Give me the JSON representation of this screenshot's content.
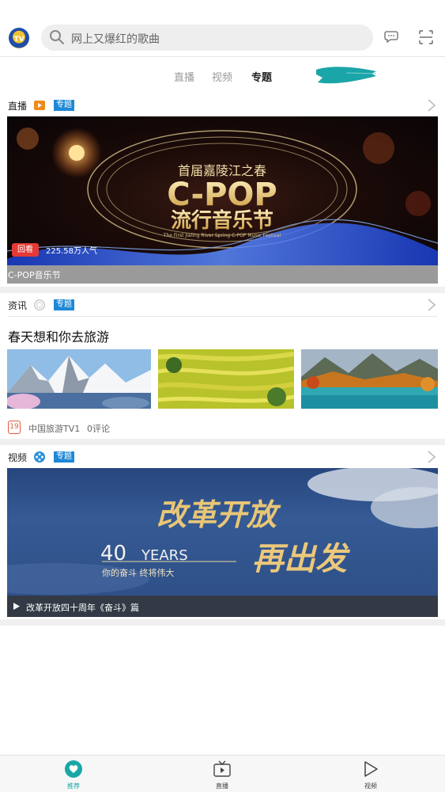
{
  "header": {
    "search_placeholder": "网上又爆红的歌曲"
  },
  "tabs": [
    {
      "label": "直播",
      "active": false
    },
    {
      "label": "视频",
      "active": false
    },
    {
      "label": "专题",
      "active": true
    }
  ],
  "sections": {
    "live": {
      "title": "直播",
      "badge": "专题",
      "icon": "live-play-icon",
      "banner": {
        "subtitle": "首届嘉陵江之春",
        "headline": "C-POP",
        "headline2": "流行音乐节",
        "english": "The First Jialing River Spring C-POP Music Festival",
        "replay_label": "回看",
        "viewers": "225.58万人气"
      },
      "caption": "C-POP音乐节"
    },
    "news": {
      "title": "资讯",
      "badge": "专题",
      "icon": "news-circle-icon",
      "article_title": "春天想和你去旅游",
      "date_badge": "19",
      "source": "中国旅游TV1",
      "comments": "0评论"
    },
    "video": {
      "title": "视频",
      "badge": "专题",
      "icon": "film-reel-icon",
      "banner": {
        "calligraphy1": "改革开放",
        "calligraphy2": "再出发",
        "years_number": "40",
        "years_text": "YEARS",
        "slogan": "你的奋斗 终将伟大"
      },
      "caption": "改革开放四十周年《奋斗》篇"
    }
  },
  "bottom_nav": [
    {
      "label": "推荐",
      "icon": "heart-icon",
      "active": true
    },
    {
      "label": "直播",
      "icon": "tv-icon",
      "active": false
    },
    {
      "label": "视频",
      "icon": "play-triangle-icon",
      "active": false
    }
  ],
  "colors": {
    "accent": "#1aa6a6",
    "badge_blue": "#1e88d6",
    "replay_red": "#e53935"
  }
}
